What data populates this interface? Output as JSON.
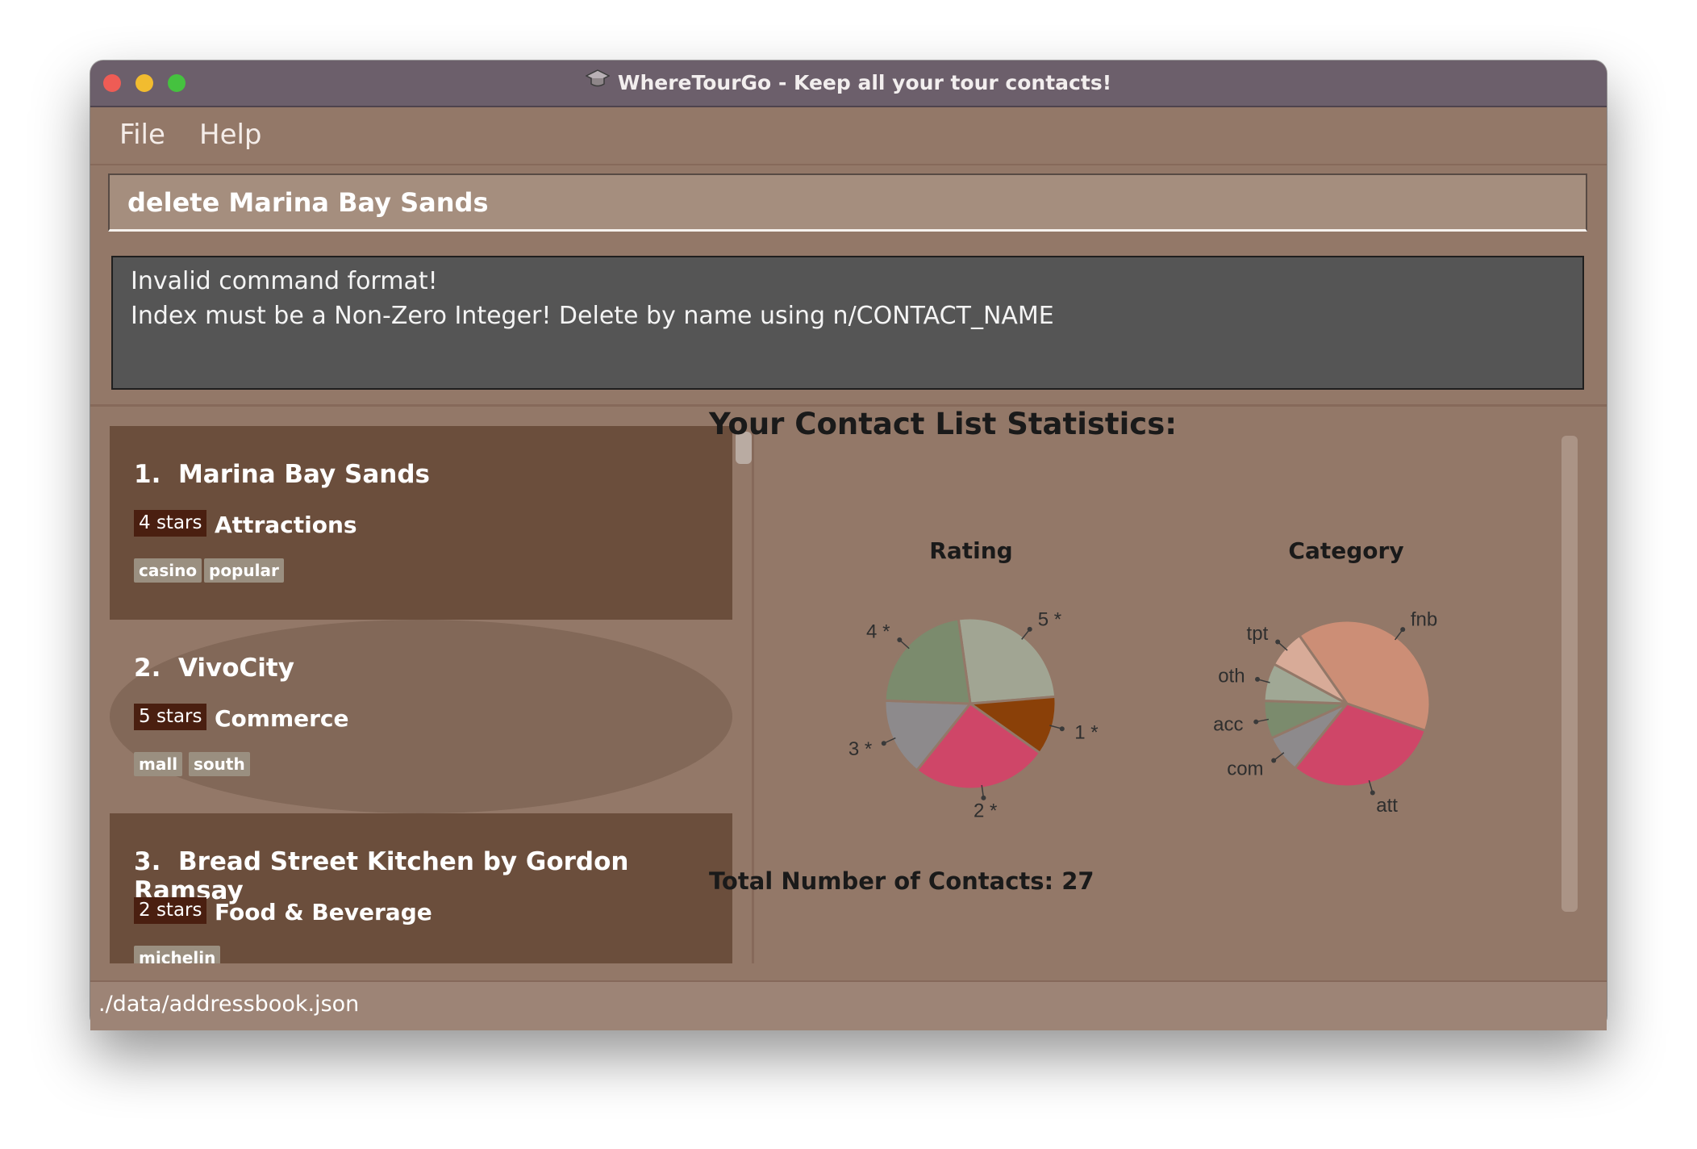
{
  "window": {
    "title": "WhereTourGo - Keep all your tour contacts!"
  },
  "menu": {
    "file": "File",
    "help": "Help"
  },
  "command": {
    "value": "delete Marina Bay Sands"
  },
  "result": {
    "line1": "Invalid command format!",
    "line2": "Index must be a Non-Zero Integer! Delete by name using n/CONTACT_NAME"
  },
  "contacts": [
    {
      "index": "1.",
      "name": "Marina Bay Sands",
      "rating": "4 stars",
      "category": "Attractions",
      "tags": [
        "casino",
        "popular"
      ]
    },
    {
      "index": "2.",
      "name": "VivoCity",
      "rating": "5 stars",
      "category": "Commerce",
      "tags": [
        "mall",
        "south"
      ]
    },
    {
      "index": "3.",
      "name": "Bread Street Kitchen by Gordon Ramsay",
      "rating": "2 stars",
      "category": "Food & Beverage",
      "tags": [
        "michelin"
      ]
    }
  ],
  "stats": {
    "heading": "Your Contact List Statistics:",
    "total_label": "Total Number of Contacts: 27"
  },
  "chart_data": [
    {
      "type": "pie",
      "title": "Rating",
      "labels": [
        "5 *",
        "1 *",
        "2 *",
        "3 *",
        "4 *"
      ],
      "values": [
        7,
        3,
        7,
        4,
        6
      ],
      "colors": [
        "#a1a593",
        "#8a4008",
        "#cf4668",
        "#8d8a8c",
        "#7b8b6d"
      ]
    },
    {
      "type": "pie",
      "title": "Category",
      "labels": [
        "fnb",
        "att",
        "com",
        "acc",
        "oth",
        "tpt"
      ],
      "values": [
        38,
        29,
        7,
        7,
        7,
        7
      ],
      "colors": [
        "#cc8e76",
        "#cf4668",
        "#8d8a8c",
        "#7b8b6d",
        "#a0a895",
        "#d8ab98"
      ]
    }
  ],
  "status": {
    "path": "./data/addressbook.json"
  }
}
